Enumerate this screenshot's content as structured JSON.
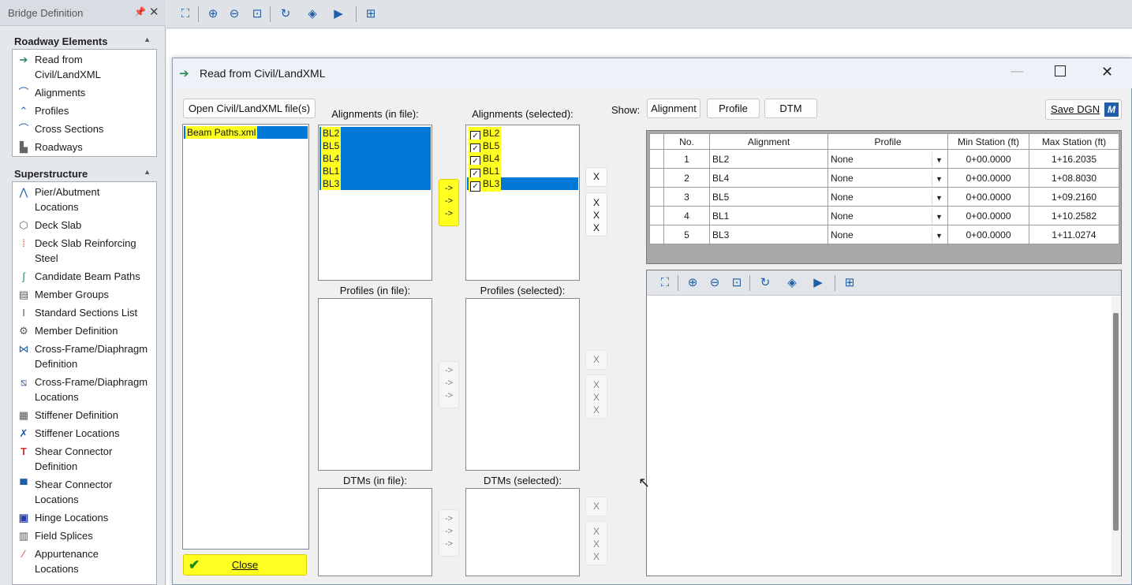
{
  "app": {
    "panel_title": "Bridge Definition",
    "roadway_section": {
      "title": "Roadway Elements",
      "items": [
        {
          "label": "Read from\nCivil/LandXML",
          "icon": "arrow-import-icon"
        },
        {
          "label": "Alignments",
          "icon": "alignment-curve-icon"
        },
        {
          "label": "Profiles",
          "icon": "profile-icon"
        },
        {
          "label": "Cross Sections",
          "icon": "cross-section-icon"
        },
        {
          "label": "Roadways",
          "icon": "roadway-icon"
        }
      ]
    },
    "superstructure_section": {
      "title": "Superstructure",
      "items": [
        {
          "label": "Pier/Abutment\nLocations"
        },
        {
          "label": "Deck Slab"
        },
        {
          "label": "Deck Slab Reinforcing\nSteel"
        },
        {
          "label": "Candidate Beam Paths"
        },
        {
          "label": "Member Groups"
        },
        {
          "label": "Standard Sections List"
        },
        {
          "label": "Member Definition"
        },
        {
          "label": "Cross-Frame/Diaphragm\nDefinition"
        },
        {
          "label": "Cross-Frame/Diaphragm\nLocations"
        },
        {
          "label": "Stiffener Definition"
        },
        {
          "label": "Stiffener Locations"
        },
        {
          "label": "Shear Connector\nDefinition"
        },
        {
          "label": "Shear Connector\nLocations"
        },
        {
          "label": "Hinge Locations"
        },
        {
          "label": "Field Splices"
        },
        {
          "label": "Appurtenance\nLocations"
        }
      ]
    }
  },
  "dialog": {
    "title": "Read from Civil/LandXML",
    "open_button": "Open Civil/LandXML file(s)",
    "files": [
      "Beam Paths.xml"
    ],
    "close_button": "Close",
    "alignments_in_file_label": "Alignments (in file):",
    "alignments_selected_label": "Alignments (selected):",
    "profiles_in_file_label": "Profiles (in file):",
    "profiles_selected_label": "Profiles (selected):",
    "dtms_in_file_label": "DTMs (in file):",
    "dtms_selected_label": "DTMs (selected):",
    "alignments_in_file": [
      "BL2",
      "BL5",
      "BL4",
      "BL1",
      "BL3"
    ],
    "alignments_selected": [
      "BL2",
      "BL5",
      "BL4",
      "BL1",
      "BL3"
    ],
    "arrow_text": "->",
    "x_text": "X",
    "show_label": "Show:",
    "show_buttons": [
      "Alignment",
      "Profile",
      "DTM"
    ],
    "save_dgn_button": "Save DGN",
    "table": {
      "headers": [
        "No.",
        "Alignment",
        "Profile",
        "Min Station (ft)",
        "Max Station (ft)"
      ],
      "rows": [
        [
          "1",
          "BL2",
          "None",
          "0+00.0000",
          "1+16.2035"
        ],
        [
          "2",
          "BL4",
          "None",
          "0+00.0000",
          "1+08.8030"
        ],
        [
          "3",
          "BL5",
          "None",
          "0+00.0000",
          "1+09.2160"
        ],
        [
          "4",
          "BL1",
          "None",
          "0+00.0000",
          "1+10.2582"
        ],
        [
          "5",
          "BL3",
          "None",
          "0+00.0000",
          "1+11.0274"
        ]
      ]
    }
  }
}
